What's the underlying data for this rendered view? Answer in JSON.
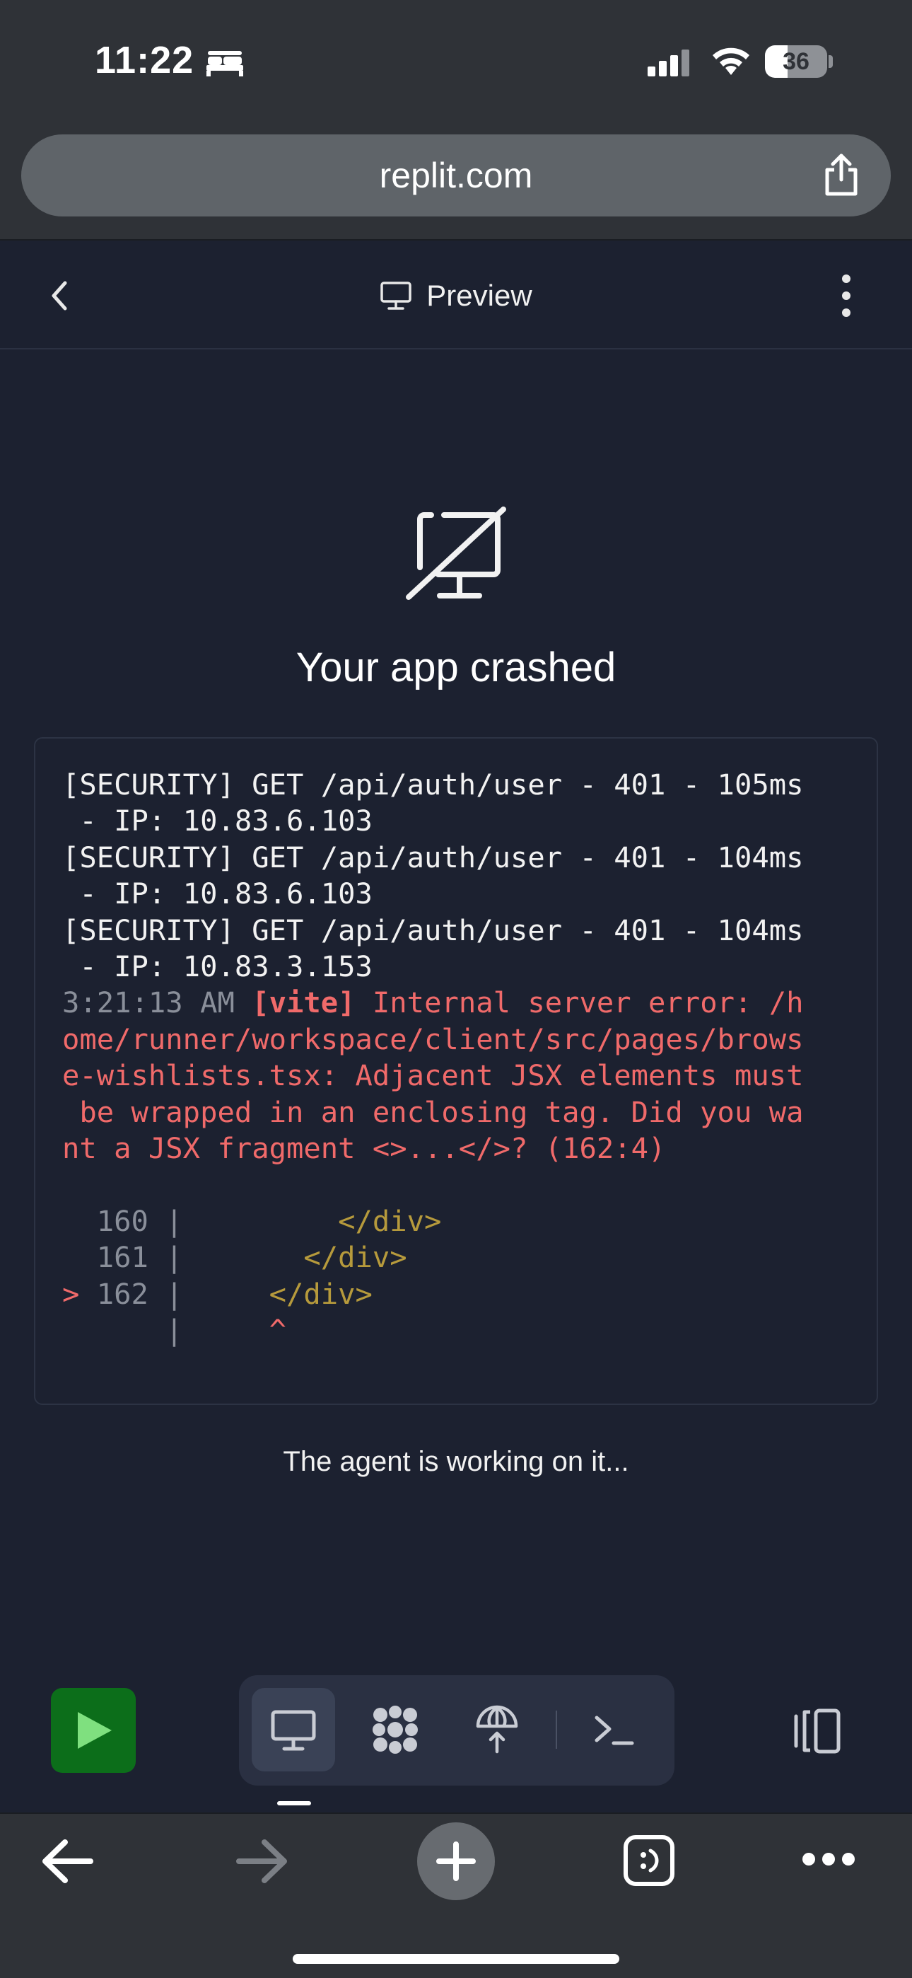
{
  "status_bar": {
    "time": "11:22",
    "battery_percent": "36",
    "battery_level": 0.36,
    "icons": [
      "sleep-focus-icon",
      "cellular-signal-icon",
      "wifi-icon",
      "battery-icon"
    ]
  },
  "browser": {
    "url": "replit.com",
    "share_icon": "share-icon"
  },
  "header": {
    "back_icon": "chevron-left-icon",
    "title": "Preview",
    "title_icon": "monitor-icon",
    "menu_icon": "more-vertical-icon"
  },
  "crash": {
    "icon": "monitor-off-icon",
    "title": "Your app crashed",
    "log_lines": [
      {
        "parts": [
          {
            "text": "[SECURITY] GET /api/auth/user - 401 - 105ms",
            "style": "white"
          }
        ]
      },
      {
        "parts": [
          {
            "text": " - IP: 10.83.6.103",
            "style": "white"
          }
        ]
      },
      {
        "parts": [
          {
            "text": "[SECURITY] GET /api/auth/user - 401 - 104ms",
            "style": "white"
          }
        ]
      },
      {
        "parts": [
          {
            "text": " - IP: 10.83.6.103",
            "style": "white"
          }
        ]
      },
      {
        "parts": [
          {
            "text": "[SECURITY] GET /api/auth/user - 401 - 104ms",
            "style": "white"
          }
        ]
      },
      {
        "parts": [
          {
            "text": " - IP: 10.83.3.153",
            "style": "white"
          }
        ]
      },
      {
        "parts": [
          {
            "text": "3:21:13 AM ",
            "style": "gray"
          },
          {
            "text": "[vite]",
            "style": "redb"
          },
          {
            "text": " Internal server error: /h",
            "style": "red"
          }
        ]
      },
      {
        "parts": [
          {
            "text": "ome/runner/workspace/client/src/pages/brows",
            "style": "red"
          }
        ]
      },
      {
        "parts": [
          {
            "text": "e-wishlists.tsx: Adjacent JSX elements must",
            "style": "red"
          }
        ]
      },
      {
        "parts": [
          {
            "text": " be wrapped in an enclosing tag. Did you wa",
            "style": "red"
          }
        ]
      },
      {
        "parts": [
          {
            "text": "nt a JSX fragment <>...</>? (162:4)",
            "style": "red"
          }
        ]
      },
      {
        "parts": [
          {
            "text": " ",
            "style": "white"
          }
        ]
      },
      {
        "parts": [
          {
            "text": "  160 | ",
            "style": "gray"
          },
          {
            "text": "        </div>",
            "style": "yellow"
          }
        ]
      },
      {
        "parts": [
          {
            "text": "  161 | ",
            "style": "gray"
          },
          {
            "text": "      </div>",
            "style": "yellow"
          }
        ]
      },
      {
        "parts": [
          {
            "text": "> ",
            "style": "red"
          },
          {
            "text": "162 | ",
            "style": "gray"
          },
          {
            "text": "    </div>",
            "style": "yellow"
          }
        ]
      },
      {
        "parts": [
          {
            "text": "      | ",
            "style": "gray"
          },
          {
            "text": "    ^",
            "style": "red"
          }
        ]
      }
    ],
    "agent_message": "The agent is working on it..."
  },
  "toolbar": {
    "run_icon": "play-icon",
    "tools": [
      {
        "name": "preview",
        "icon": "monitor-icon",
        "active": true
      },
      {
        "name": "agent",
        "icon": "agent-icon",
        "active": false
      },
      {
        "name": "deploy",
        "icon": "deploy-icon",
        "active": false
      },
      {
        "name": "shell",
        "icon": "terminal-icon",
        "active": false
      }
    ],
    "layout_icon": "split-pane-icon"
  },
  "safari_nav": {
    "back_icon": "arrow-left-icon",
    "forward_icon": "arrow-right-icon",
    "new_tab_icon": "plus-icon",
    "tabs_icon": "tabs-icon",
    "more_icon": "more-horizontal-icon"
  },
  "colors": {
    "background": "#1c2130",
    "browser_chrome": "#2f3237",
    "error_red": "#f06a6a",
    "code_yellow": "#b69a3c",
    "run_green": "#0c6e1a"
  }
}
